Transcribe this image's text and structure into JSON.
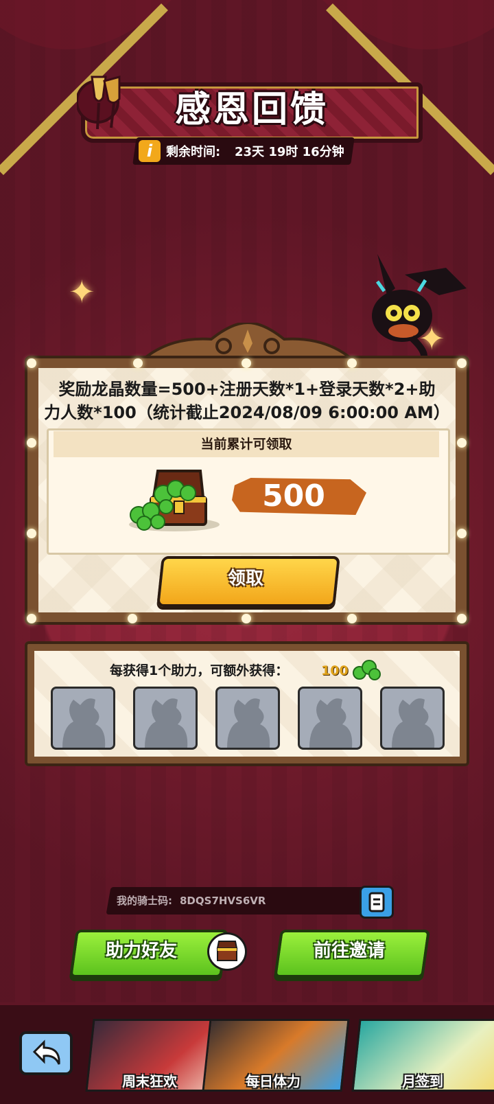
{
  "header": {
    "title": "感恩回馈",
    "timer_label": "剩余时间:",
    "timer_value": "23天 19时 16分钟"
  },
  "reward_panel": {
    "rule_line1": "奖励龙晶数量=500+注册天数*1+登录天数*2+助",
    "rule_line2": "力人数*100（统计截止2024/08/09 6:00:00 AM）",
    "accumulated_header": "当前累计可领取",
    "amount": "500",
    "claim_label": "领取"
  },
  "helper_panel": {
    "text": "每获得1个助力，可额外获得：",
    "bonus": "100",
    "slots": 5
  },
  "knight_code": {
    "label": "我的骑士码:",
    "value": "8DQS7HVS6VR"
  },
  "actions": {
    "assist_friend": "助力好友",
    "go_invite": "前往邀请"
  },
  "bottom_nav": {
    "items": [
      {
        "label": "周末狂欢"
      },
      {
        "label": "每日体力"
      },
      {
        "label": "月签到"
      }
    ]
  },
  "colors": {
    "accent_gold": "#f2a61a",
    "accent_green": "#5dc21e",
    "curtain": "#7c1f2f",
    "panel_wood": "#7a5130"
  }
}
